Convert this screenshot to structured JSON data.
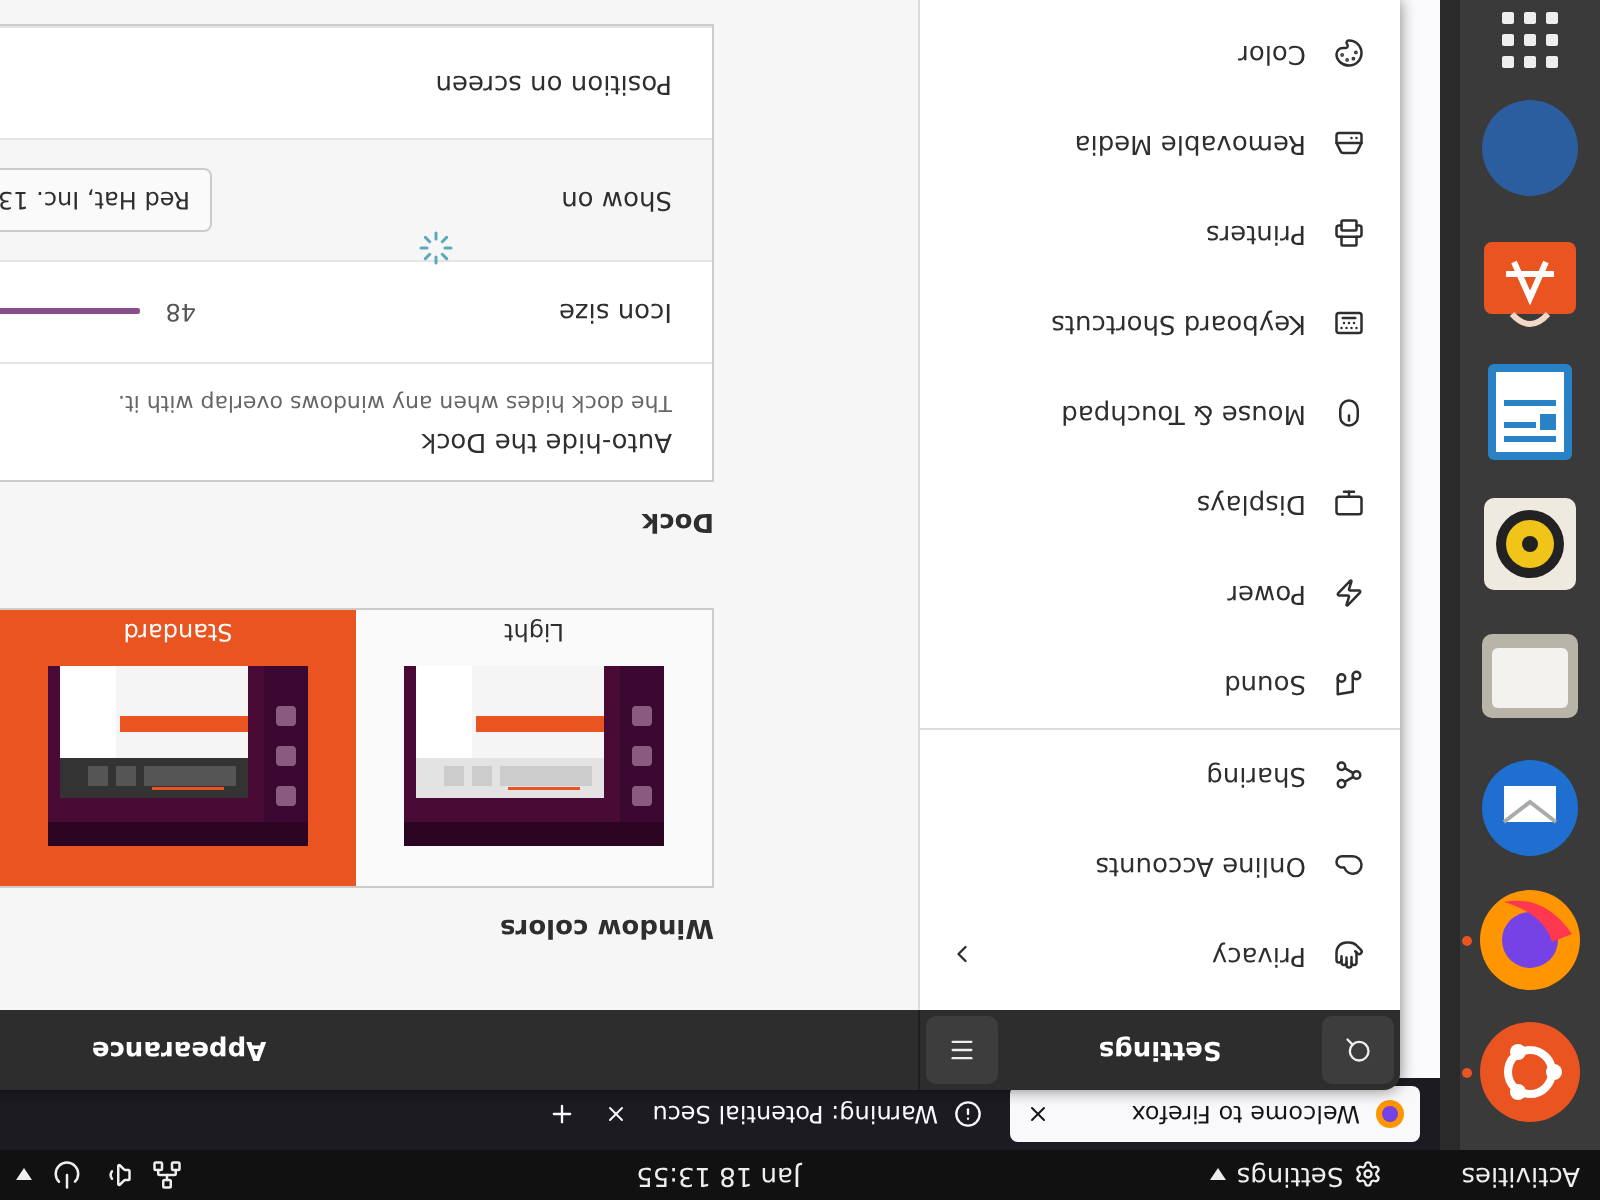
{
  "top_bar": {
    "activities": "Activities",
    "app_menu": "Settings",
    "clock": "Jan 18 13:55"
  },
  "dock": [
    {
      "running": true
    },
    {
      "running": true
    },
    {
      "running": false
    },
    {
      "running": false
    },
    {
      "running": false
    },
    {
      "running": false
    },
    {
      "running": false
    },
    {
      "running": false
    }
  ],
  "browser": {
    "tabs": [
      {
        "title": "Welcome to Firefox",
        "selected": true
      },
      {
        "title": "Warning: Potential Secu",
        "selected": false
      }
    ]
  },
  "settings": {
    "title": "Settings",
    "page_title": "Appearance",
    "sidebar": {
      "groups": [
        [
          {
            "label": "Privacy",
            "has_submenu": true
          },
          {
            "label": "Online Accounts",
            "has_submenu": false
          },
          {
            "label": "Sharing",
            "has_submenu": false
          }
        ],
        [
          {
            "label": "Sound",
            "has_submenu": false
          },
          {
            "label": "Power",
            "has_submenu": false
          },
          {
            "label": "Displays",
            "has_submenu": false
          },
          {
            "label": "Mouse & Touchpad",
            "has_submenu": false
          },
          {
            "label": "Keyboard Shortcuts",
            "has_submenu": false
          },
          {
            "label": "Printers",
            "has_submenu": false
          },
          {
            "label": "Removable Media",
            "has_submenu": false
          },
          {
            "label": "Color",
            "has_submenu": false
          }
        ]
      ]
    },
    "window_colors": {
      "heading": "Window colors",
      "options": [
        {
          "label": "Light",
          "kind": "light",
          "selected": false
        },
        {
          "label": "Standard",
          "kind": "standard",
          "selected": true
        }
      ]
    },
    "dock_section": {
      "heading": "Dock",
      "rows": [
        {
          "kind": "text",
          "label": "Auto-hide the Dock",
          "description": "The dock hides when any windows overlap with it."
        },
        {
          "kind": "slider",
          "label": "Icon size",
          "reading": "48",
          "level": 0.67
        },
        {
          "kind": "dropdown",
          "label": "Show on",
          "value": "Red Hat, Inc. 13"
        },
        {
          "kind": "plain",
          "label": "Position on screen"
        }
      ]
    }
  }
}
